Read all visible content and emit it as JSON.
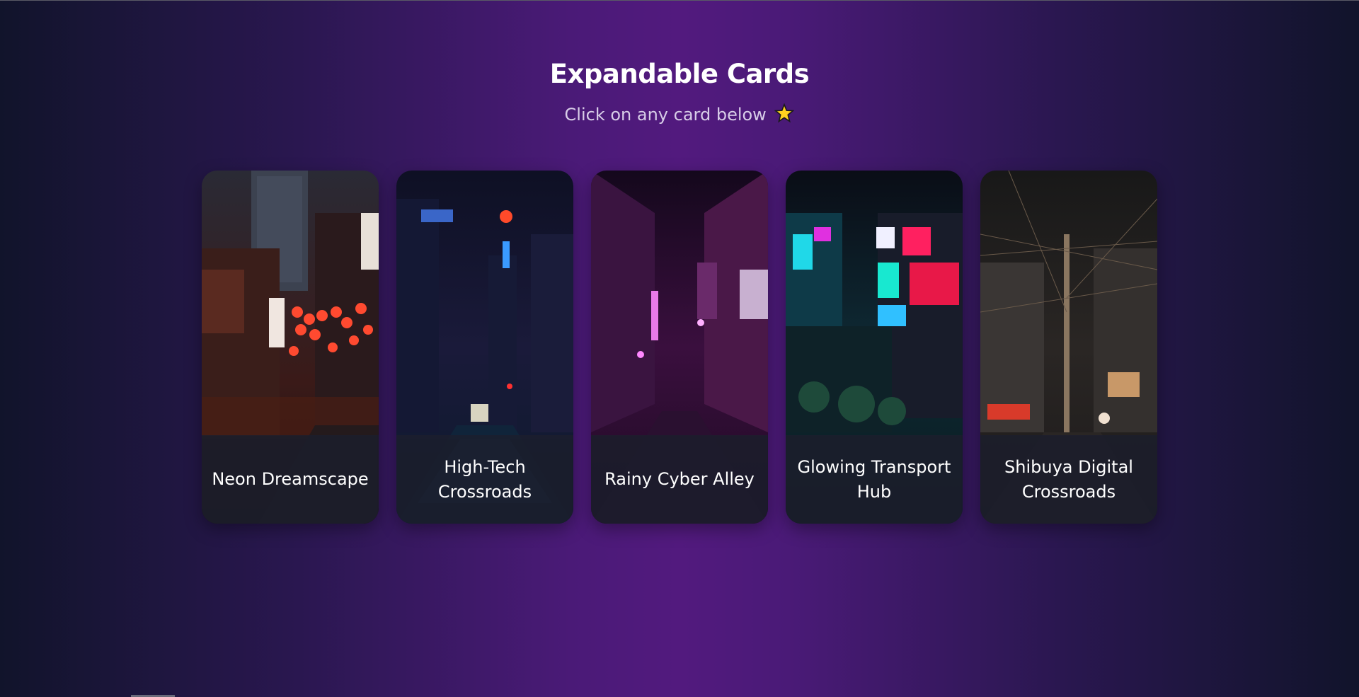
{
  "header": {
    "title": "Expandable Cards",
    "subtitle": "Click on any card below",
    "subtitle_icon": "star-icon"
  },
  "cards": [
    {
      "label": "Neon Dreamscape",
      "palette": "red-lantern-street"
    },
    {
      "label": "High-Tech Crossroads",
      "palette": "blue-wet-road"
    },
    {
      "label": "Rainy Cyber Alley",
      "palette": "magenta-alley"
    },
    {
      "label": "Glowing Transport Hub",
      "palette": "cyan-neon-crossing"
    },
    {
      "label": "Shibuya Digital Crossroads",
      "palette": "dim-powerline-street"
    }
  ],
  "colors": {
    "background_center": "#521a7e",
    "background_edge": "#11142b",
    "label_panel": "#1c1f2d"
  }
}
